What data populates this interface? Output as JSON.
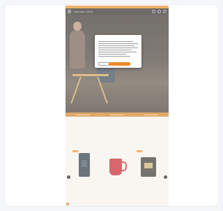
{
  "promo_bar": {
    "text": ""
  },
  "navbar": {
    "logo": "espresso store"
  },
  "hero": {
    "text": ""
  },
  "section": {
    "title": "",
    "subtitle": "",
    "script_text": ""
  },
  "products": [
    {
      "name": "",
      "price": ""
    },
    {
      "name": "",
      "price": ""
    },
    {
      "name": "",
      "price": ""
    }
  ],
  "cookie_modal": {
    "title": "",
    "link": "",
    "reject_label": "",
    "accept_label": ""
  },
  "colors": {
    "accent": "#ee8b2a",
    "hero_dark": "#1b1814",
    "mug_red": "#c0181f",
    "card_bg": "#ffffff",
    "page_bg": "#eef1f5"
  }
}
